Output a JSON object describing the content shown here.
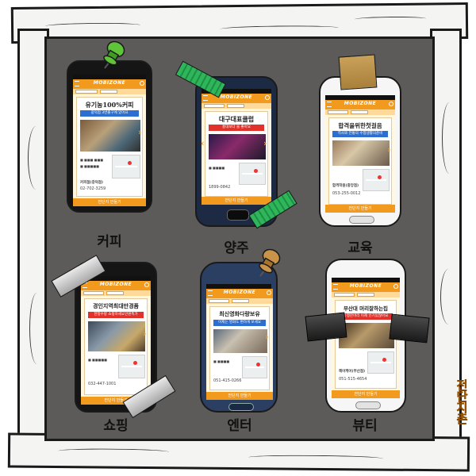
{
  "app": {
    "brand": "MOBIZONE"
  },
  "logo": {
    "text": "전단지촌"
  },
  "common": {
    "button": "전단지 만들기"
  },
  "colors": {
    "accent": "#f29a1d",
    "board": "#5c5b5a",
    "red": "#e0322a",
    "blue": "#2d6fd1"
  },
  "phones": [
    {
      "category": "커피",
      "title": "유기농100%커피",
      "subtitle": "광덕점 3번출구에 있어요",
      "phone": "02-702-3259",
      "store": "커피점(광덕점)",
      "tape": "pushpin-green"
    },
    {
      "category": "양주",
      "title": "대구대표클럽",
      "subtitle": "홍대보다 물 좋아요",
      "phone": "1899-0842",
      "store": "",
      "tape": "green-tape"
    },
    {
      "category": "교육",
      "title": "합격을위한첫걸음",
      "subtitle": "역사와 전통의 수험생활의준비",
      "phone": "053-255-0012",
      "store": "합격학원(중앙점)",
      "tape": "brown-tape"
    },
    {
      "category": "쇼핑",
      "title": "경인지역최대만경품",
      "subtitle": "한정수량 쇼핑하세요만원특가",
      "phone": "032-447-1001",
      "store": "",
      "tape": "silver-tape"
    },
    {
      "category": "엔터",
      "title": "최신영화다량보유",
      "subtitle": "이제는 영화도 편하게 보세요",
      "phone": "051-415-0266",
      "store": "",
      "tape": "pushpin-brown"
    },
    {
      "category": "뷰티",
      "title": "부산대 머리잘하는집",
      "subtitle": "유행한머리 이제 인기있잖아요",
      "phone": "051-515-4654",
      "store": "헤어케어(부산점)",
      "tape": "black-tape"
    }
  ]
}
